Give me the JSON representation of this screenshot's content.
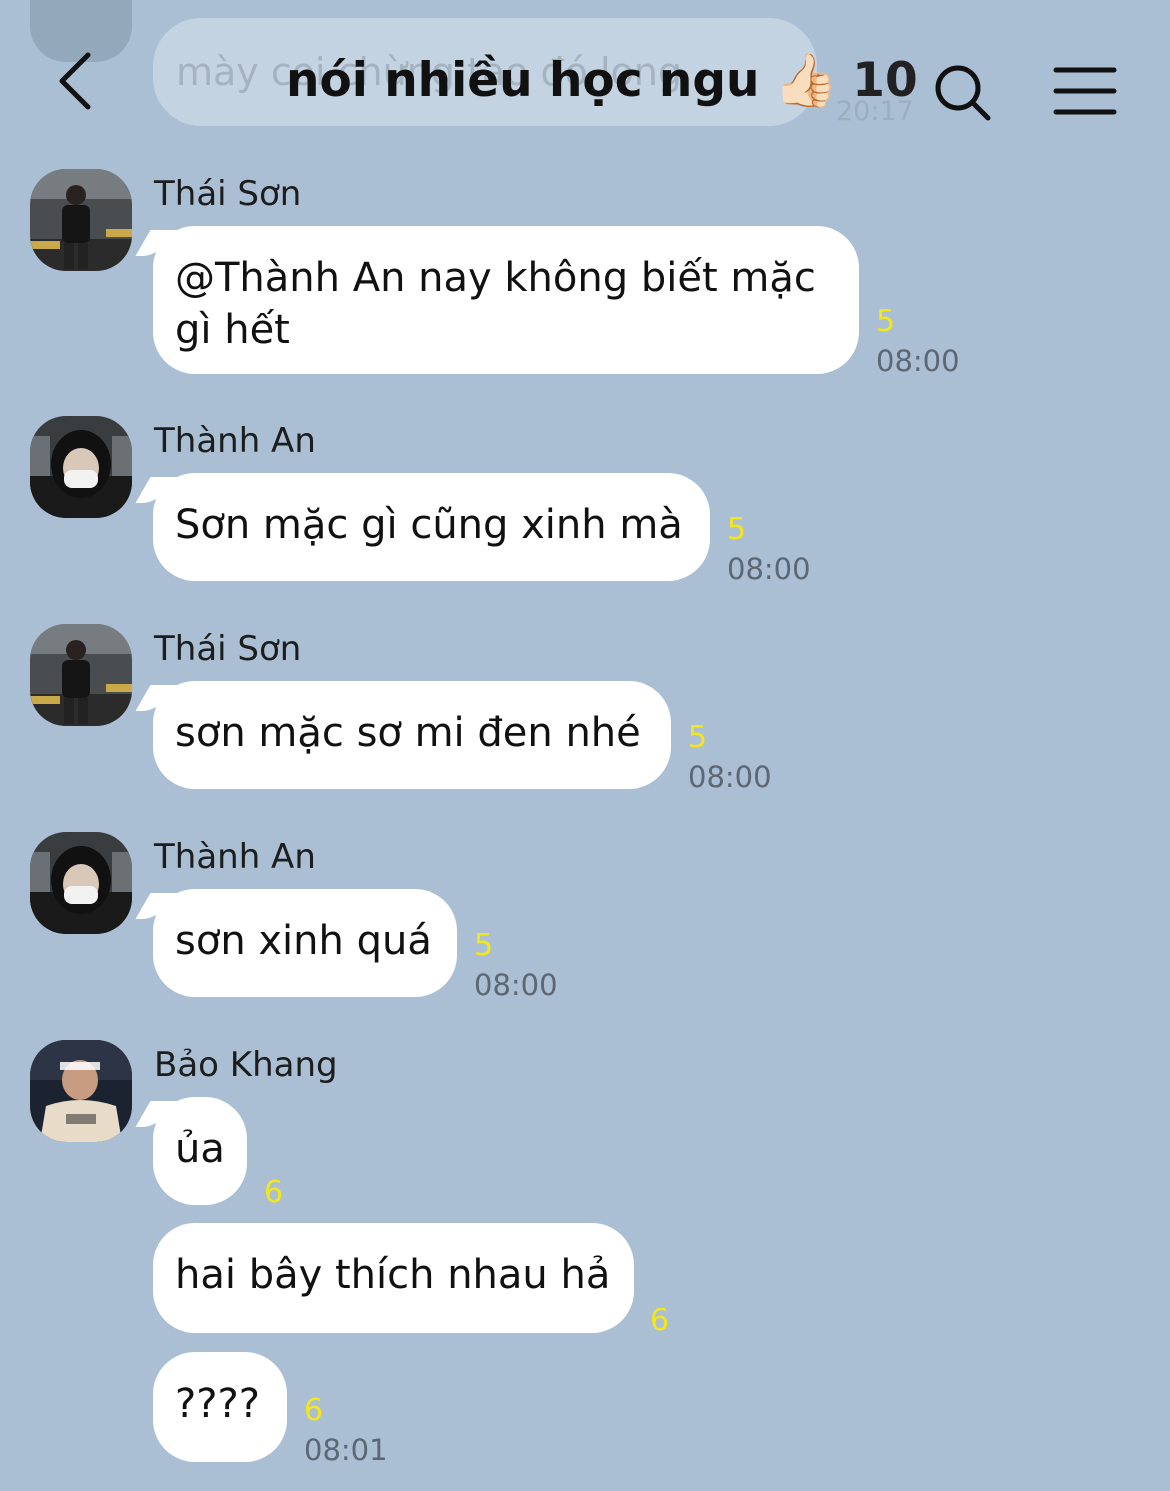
{
  "header": {
    "title": "nói nhiều học ngu",
    "title_emoji": "👍🏻",
    "member_count": "10",
    "icons": {
      "back": "chevron-left-icon",
      "search": "search-icon",
      "menu": "hamburger-menu-icon"
    }
  },
  "background_message": {
    "text": "mày coi chừng tao đó long",
    "time": "20:17"
  },
  "messages": [
    {
      "sender": "Thái Sơn",
      "text_line1": "@Thành An nay không biết mặc",
      "text_line2": "gì hết",
      "read_count": "5",
      "time": "08:00"
    },
    {
      "sender": "Thành An",
      "text": "Sơn mặc gì cũng xinh mà",
      "read_count": "5",
      "time": "08:00"
    },
    {
      "sender": "Thái Sơn",
      "text": "sơn mặc sơ mi đen nhé",
      "read_count": "5",
      "time": "08:00"
    },
    {
      "sender": "Thành An",
      "text": "sơn xinh quá",
      "read_count": "5",
      "time": "08:00"
    },
    {
      "sender": "Bảo Khang",
      "text": "ủa",
      "read_count": "6"
    },
    {
      "text": "hai bây thích nhau hả",
      "read_count": "6"
    },
    {
      "text": "????",
      "read_count": "6",
      "time": "08:01"
    }
  ],
  "colors": {
    "background": "#aabfd3",
    "bubble": "#ffffff",
    "read_count": "#f4e619",
    "timestamp": "#5c6773"
  }
}
